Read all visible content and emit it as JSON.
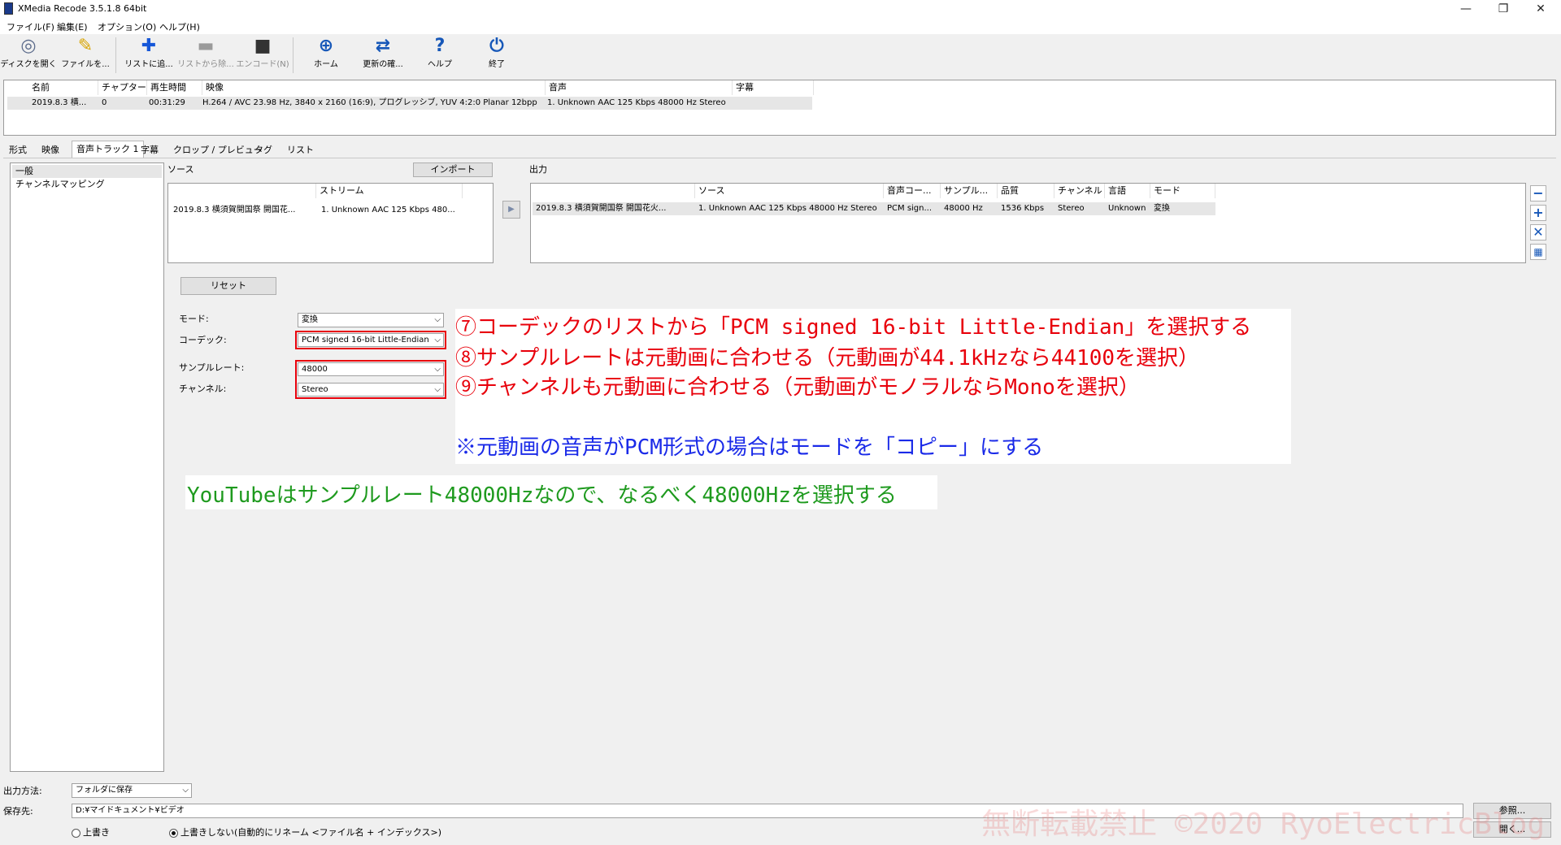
{
  "window": {
    "title": "XMedia Recode 3.5.1.8 64bit",
    "minimize": "—",
    "restore": "❐",
    "close": "✕"
  },
  "menu": [
    "ファイル(F)",
    "編集(E)",
    "オプション(O)",
    "ヘルプ(H)"
  ],
  "toolbar": [
    {
      "label": "ディスクを開く",
      "icon": "disc-icon",
      "glyph": "◎",
      "color": "#5a6a8a",
      "enabled": true
    },
    {
      "label": "ファイルを...",
      "icon": "open-file-icon",
      "glyph": "✎",
      "color": "#d8a400",
      "enabled": true
    },
    {
      "label": "リストに追...",
      "icon": "add-to-list-icon",
      "glyph": "✚",
      "color": "#1657d8",
      "enabled": true
    },
    {
      "label": "リストから除...",
      "icon": "remove-from-list-icon",
      "glyph": "▬",
      "color": "#666",
      "enabled": false
    },
    {
      "label": "エンコード(N)",
      "icon": "encode-icon",
      "glyph": "■",
      "color": "#333",
      "enabled": false
    },
    {
      "label": "ホーム",
      "icon": "globe-icon",
      "glyph": "⊕",
      "color": "#1657b8",
      "enabled": true
    },
    {
      "label": "更新の確...",
      "icon": "refresh-icon",
      "glyph": "⇄",
      "color": "#1657b8",
      "enabled": true
    },
    {
      "label": "ヘルプ",
      "icon": "help-icon",
      "glyph": "?",
      "color": "#1657b8",
      "enabled": true
    },
    {
      "label": "終了",
      "icon": "power-icon",
      "glyph": "⏻",
      "color": "#1657b8",
      "enabled": true
    }
  ],
  "filelist": {
    "headers": [
      "名前",
      "チャプター",
      "再生時間",
      "映像",
      "音声",
      "字幕"
    ],
    "row": [
      "2019.8.3 横...",
      "0",
      "00:31:29",
      "H.264 / AVC  23.98 Hz, 3840 x 2160 (16:9), プログレッシブ, YUV 4:2:0 Planar 12bpp",
      "1. Unknown AAC  125 Kbps 48000 Hz Stereo",
      ""
    ]
  },
  "tabs": [
    "形式",
    "映像",
    "音声トラック 1",
    "字幕",
    "クロップ / プレビュー",
    "タグ",
    "リスト"
  ],
  "nav": [
    "一般",
    "チャンネルマッピング"
  ],
  "source": {
    "label": "ソース",
    "import": "インポート",
    "headers": [
      "",
      "ストリーム"
    ],
    "row": [
      "2019.8.3 横須賀開国祭 開国花...",
      "1. Unknown AAC  125 Kbps 480..."
    ]
  },
  "output": {
    "label": "出力",
    "headers": [
      "",
      "ソース",
      "音声コー...",
      "サンプル...",
      "品質",
      "チャンネル",
      "言語",
      "モード"
    ],
    "row": [
      "2019.8.3 横須賀開国祭 開国花火...",
      "1. Unknown AAC  125 Kbps 48000 Hz Stereo",
      "PCM sign...",
      "48000 Hz",
      "1536 Kbps",
      "Stereo",
      "Unknown",
      "変換"
    ]
  },
  "form": {
    "reset": "リセット",
    "mode_label": "モード:",
    "mode": "変換",
    "codec_label": "コーデック:",
    "codec": "PCM signed 16-bit Little-Endian",
    "samplerate_label": "サンプルレート:",
    "samplerate": "48000",
    "channel_label": "チャンネル:",
    "channel": "Stereo"
  },
  "annotations": {
    "line1": "⑦コーデックのリストから「PCM signed 16-bit Little-Endian」を選択する",
    "line2": "⑧サンプルレートは元動画に合わせる（元動画が44.1kHzなら44100を選択）",
    "line3": "⑨チャンネルも元動画に合わせる（元動画がモノラルならMonoを選択）",
    "note": "※元動画の音声がPCM形式の場合はモードを「コピー」にする",
    "green": "YouTubeはサンプルレート48000Hzなので、なるべく48000Hzを選択する",
    "red_color": "#e8000b",
    "blue_color": "#1a2ae8",
    "green_color": "#1e9a1e"
  },
  "bottom": {
    "output_method_label": "出力方法:",
    "output_method": "フォルダに保存",
    "dest_label": "保存先:",
    "dest": "D:¥マイドキュメント¥ビデオ",
    "browse": "参照...",
    "open": "開く...",
    "overwrite": "上書き",
    "no_overwrite": "上書きしない(自動的にリネーム <ファイル名 + インデックス>)"
  },
  "watermark": "無断転載禁止  ©2020 RyoElectricBlog"
}
